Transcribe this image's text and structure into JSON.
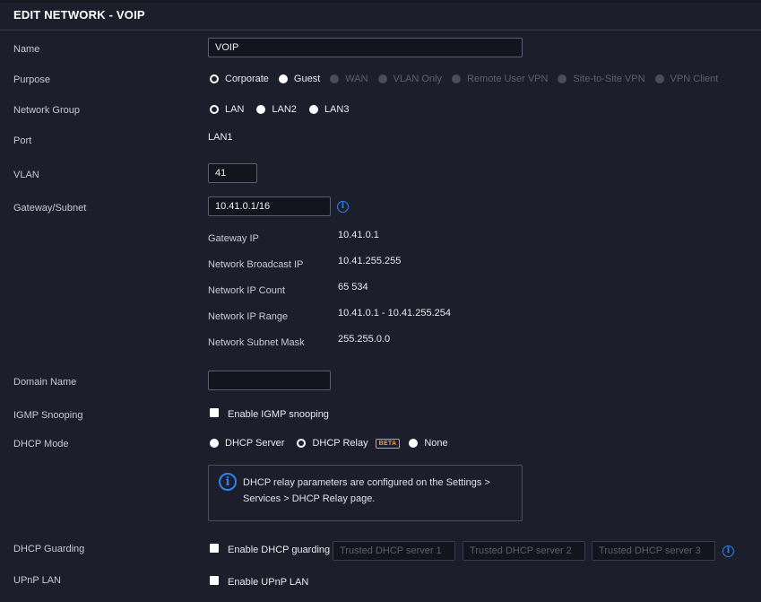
{
  "header": {
    "title": "EDIT NETWORK - VOIP"
  },
  "form": {
    "name": {
      "label": "Name",
      "value": "VOIP"
    },
    "purpose": {
      "label": "Purpose",
      "options": [
        {
          "label": "Corporate",
          "state": "checked"
        },
        {
          "label": "Guest",
          "state": "unchecked"
        },
        {
          "label": "WAN",
          "state": "disabled"
        },
        {
          "label": "VLAN Only",
          "state": "disabled"
        },
        {
          "label": "Remote User VPN",
          "state": "disabled"
        },
        {
          "label": "Site-to-Site VPN",
          "state": "disabled"
        },
        {
          "label": "VPN Client",
          "state": "disabled"
        }
      ]
    },
    "network_group": {
      "label": "Network Group",
      "options": [
        {
          "label": "LAN",
          "state": "checked"
        },
        {
          "label": "LAN2",
          "state": "unchecked"
        },
        {
          "label": "LAN3",
          "state": "unchecked"
        }
      ]
    },
    "port": {
      "label": "Port",
      "value": "LAN1"
    },
    "vlan": {
      "label": "VLAN",
      "value": "41"
    },
    "gateway_subnet": {
      "label": "Gateway/Subnet",
      "value": "10.41.0.1/16"
    },
    "subnet_info": {
      "gateway_ip": {
        "label": "Gateway IP",
        "value": "10.41.0.1"
      },
      "broadcast_ip": {
        "label": "Network Broadcast IP",
        "value": "10.41.255.255"
      },
      "ip_count": {
        "label": "Network IP Count",
        "value": "65 534"
      },
      "ip_range": {
        "label": "Network IP Range",
        "value": "10.41.0.1 - 10.41.255.254"
      },
      "subnet_mask": {
        "label": "Network Subnet Mask",
        "value": "255.255.0.0"
      }
    },
    "domain_name": {
      "label": "Domain Name",
      "value": ""
    },
    "igmp": {
      "label": "IGMP Snooping",
      "checkbox_label": "Enable IGMP snooping"
    },
    "dhcp_mode": {
      "label": "DHCP Mode",
      "server_label": "DHCP Server",
      "relay_label": "DHCP Relay",
      "beta_badge": "BETA",
      "none_label": "None",
      "notice": "DHCP relay parameters are configured on the Settings > Services > DHCP Relay page."
    },
    "dhcp_guarding": {
      "label": "DHCP Guarding",
      "checkbox_label": "Enable DHCP guarding",
      "server1_placeholder": "Trusted DHCP server 1",
      "server2_placeholder": "Trusted DHCP server 2",
      "server3_placeholder": "Trusted DHCP server 3"
    },
    "upnp": {
      "label": "UPnP LAN",
      "checkbox_label": "Enable UPnP LAN"
    }
  },
  "icons": {
    "info": "info-icon"
  },
  "colors": {
    "accent": "#2d82f0",
    "beta": "#f0a030",
    "background": "#1d1e2c"
  }
}
